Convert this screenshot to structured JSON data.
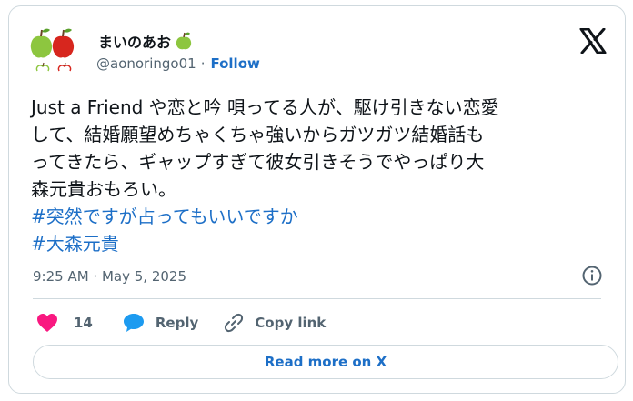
{
  "author": {
    "display_name": "まいのあお",
    "handle": "@aonoringo01",
    "separator": "·",
    "follow_label": "Follow"
  },
  "post": {
    "lines": [
      "Just a Friend や恋と吟 唄ってる人が、駆け引きない恋愛",
      "して、結婚願望めちゃくちゃ強いからガツガツ結婚話も",
      "ってきたら、ギャップすぎて彼女引きそうでやっぱり大",
      "森元貴おもろい。"
    ],
    "hashtags": [
      "#突然ですが占ってもいいですか",
      "#大森元貴"
    ]
  },
  "timestamp": "9:25 AM · May 5, 2025",
  "actions": {
    "like_count": "14",
    "reply_label": "Reply",
    "copy_link_label": "Copy link"
  },
  "read_more_label": "Read more on X",
  "colors": {
    "link": "#1d6fc7",
    "text": "#0f1419",
    "muted": "#536471",
    "like": "#f91880",
    "reply": "#1d9bf0",
    "border": "#cfd9de"
  },
  "icons": {
    "avatar": "apple-avatar-icon",
    "name_badge": "green-apple-icon",
    "x_logo": "x-logo-icon",
    "info": "info-icon",
    "like": "heart-icon",
    "reply": "speech-bubble-icon",
    "copy_link": "link-icon"
  }
}
